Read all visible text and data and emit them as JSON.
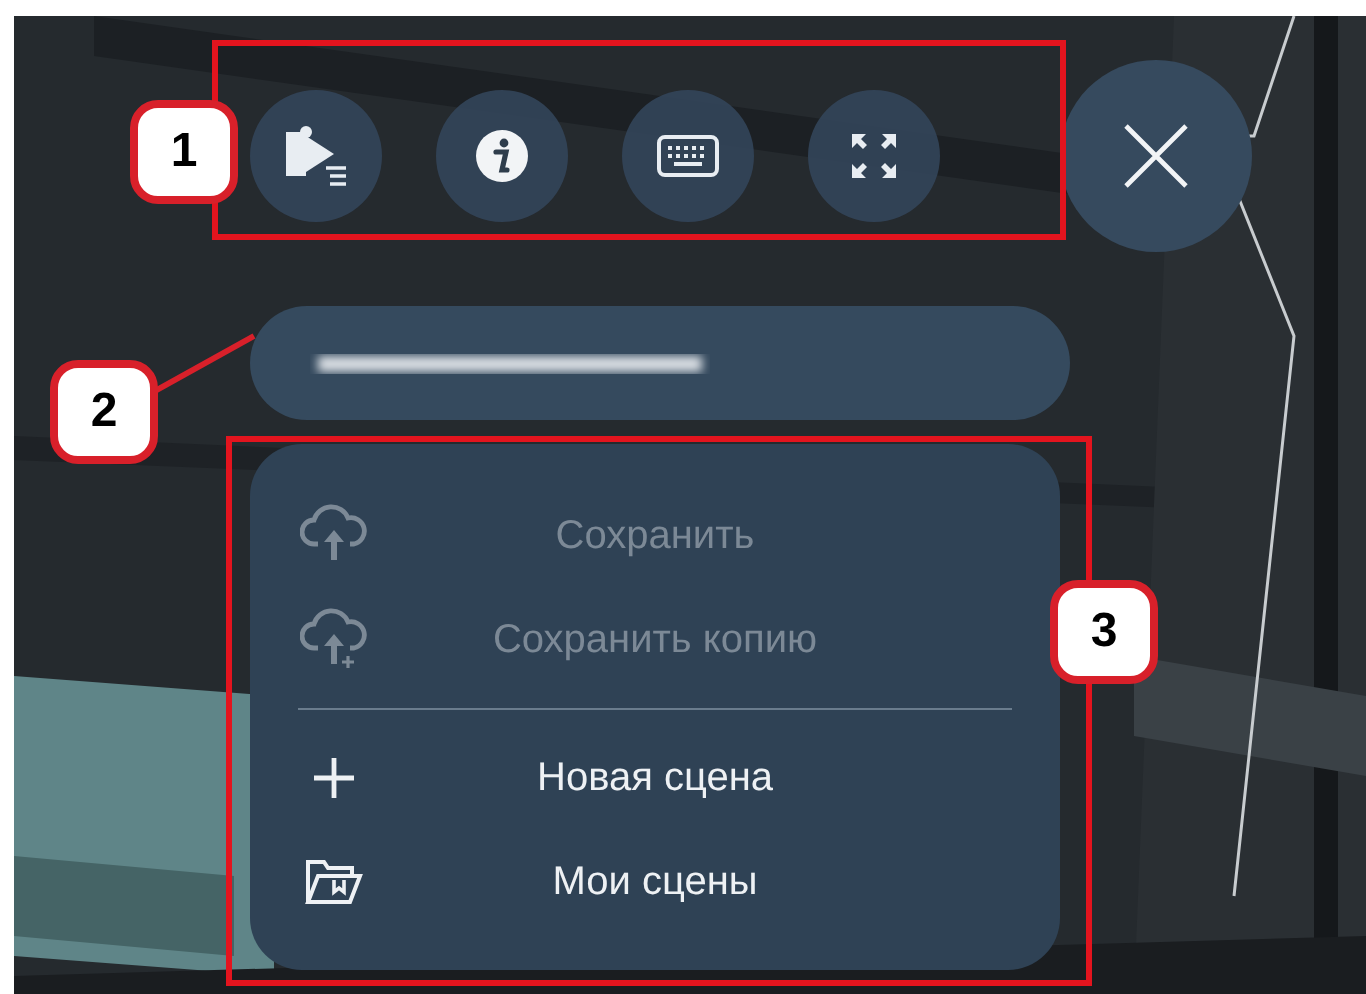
{
  "toolbar": {
    "buttons": [
      {
        "kind": "presentation"
      },
      {
        "kind": "info"
      },
      {
        "kind": "keyboard"
      },
      {
        "kind": "fullscreen"
      }
    ]
  },
  "close_button": {
    "kind": "close"
  },
  "scene_menu": {
    "items": [
      {
        "kind": "cloud-upload",
        "label": "Сохранить",
        "disabled": true
      },
      {
        "kind": "cloud-upload-plus",
        "label": "Сохранить копию",
        "disabled": true
      },
      {
        "kind": "plus",
        "label": "Новая сцена",
        "disabled": false
      },
      {
        "kind": "folder",
        "label": "Мои сцены",
        "disabled": false
      }
    ]
  },
  "callouts": [
    {
      "label": "1"
    },
    {
      "label": "2"
    },
    {
      "label": "3"
    }
  ]
}
